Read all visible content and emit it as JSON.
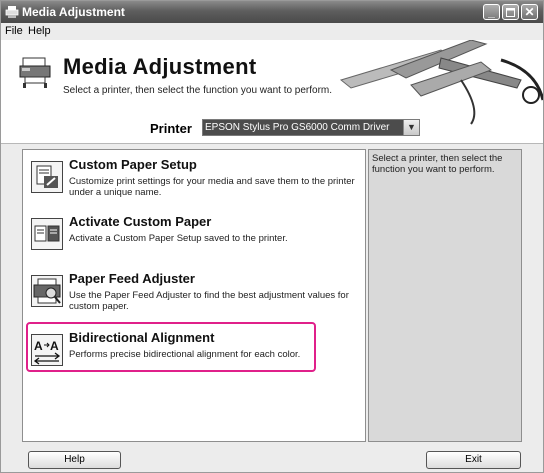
{
  "window": {
    "title": "Media Adjustment"
  },
  "menu": [
    {
      "label": "File"
    },
    {
      "label": "Help"
    }
  ],
  "header": {
    "title": "Media Adjustment",
    "subtitle": "Select a printer, then select the function you want to perform.",
    "printer_label": "Printer",
    "printer_value": "EPSON Stylus Pro GS6000 Comm Driver"
  },
  "functions": [
    {
      "title": "Custom Paper Setup",
      "description": "Customize print settings for your media and save them to the printer under a unique name.",
      "icon": "custom-paper-setup-icon"
    },
    {
      "title": "Activate Custom Paper",
      "description": "Activate a Custom Paper Setup saved to the printer.",
      "icon": "activate-custom-paper-icon"
    },
    {
      "title": "Paper Feed Adjuster",
      "description": "Use the Paper Feed Adjuster to find the best adjustment values for custom paper.",
      "icon": "paper-feed-adjuster-icon"
    },
    {
      "title": "Bidirectional Alignment",
      "description": "Performs precise bidirectional alignment for each color.",
      "icon": "bidirectional-alignment-icon"
    }
  ],
  "info_panel": {
    "text": "Select a printer, then select the function you want to perform."
  },
  "buttons": {
    "help": "Help",
    "exit": "Exit"
  },
  "colors": {
    "highlight": "#e0208a",
    "titlebar": "#5e5e5e",
    "selection": "#4c4c4c"
  }
}
